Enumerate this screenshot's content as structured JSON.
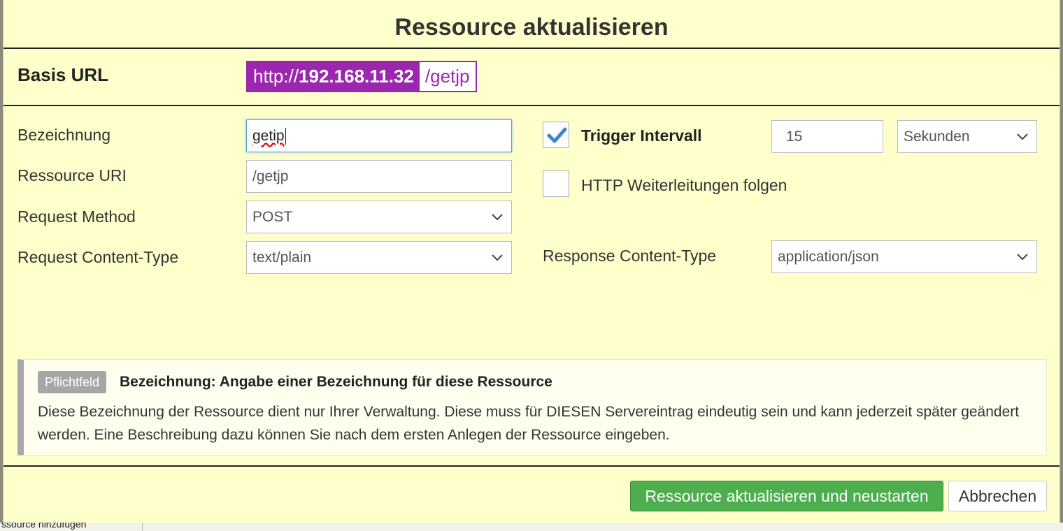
{
  "dialog": {
    "title": "Ressource aktualisieren"
  },
  "base_url": {
    "label": "Basis URL",
    "prefix": "http://",
    "host": "192.168.11.32",
    "path": "/getjp"
  },
  "form": {
    "name": {
      "label": "Bezeichnung",
      "value": "getip"
    },
    "uri": {
      "label": "Ressource URI",
      "value": "/getjp"
    },
    "method": {
      "label": "Request Method",
      "value": "POST"
    },
    "req_content_type": {
      "label": "Request Content-Type",
      "value": "text/plain"
    },
    "trigger": {
      "label": "Trigger Intervall",
      "checked": true,
      "value": "15",
      "unit": "Sekunden"
    },
    "redirects": {
      "label": "HTTP Weiterleitungen folgen",
      "checked": false
    },
    "resp_content_type": {
      "label": "Response Content-Type",
      "value": "application/json"
    }
  },
  "help": {
    "badge": "Pflichtfeld",
    "title": "Bezeichnung: Angabe einer Bezeichnung für diese Ressource",
    "body": "Diese Bezeichnung der Ressource dient nur Ihrer Verwaltung. Diese muss für DIESEN Servereintrag eindeutig sein und kann jederzeit später geändert werden. Eine Beschreibung dazu können Sie nach dem ersten Anlegen der Ressource eingeben."
  },
  "buttons": {
    "submit": "Ressource aktualisieren und neustarten",
    "cancel": "Abbrechen"
  },
  "background": {
    "partial_text": "ssource hinzufügen"
  },
  "colors": {
    "dialog_bg": "#ffffcc",
    "url_accent": "#9b27af",
    "primary_button": "#4cae4c",
    "check": "#3b86c8"
  },
  "icons": {
    "checkbox_checked": "check-icon",
    "select_arrow": "chevron-down-icon"
  }
}
